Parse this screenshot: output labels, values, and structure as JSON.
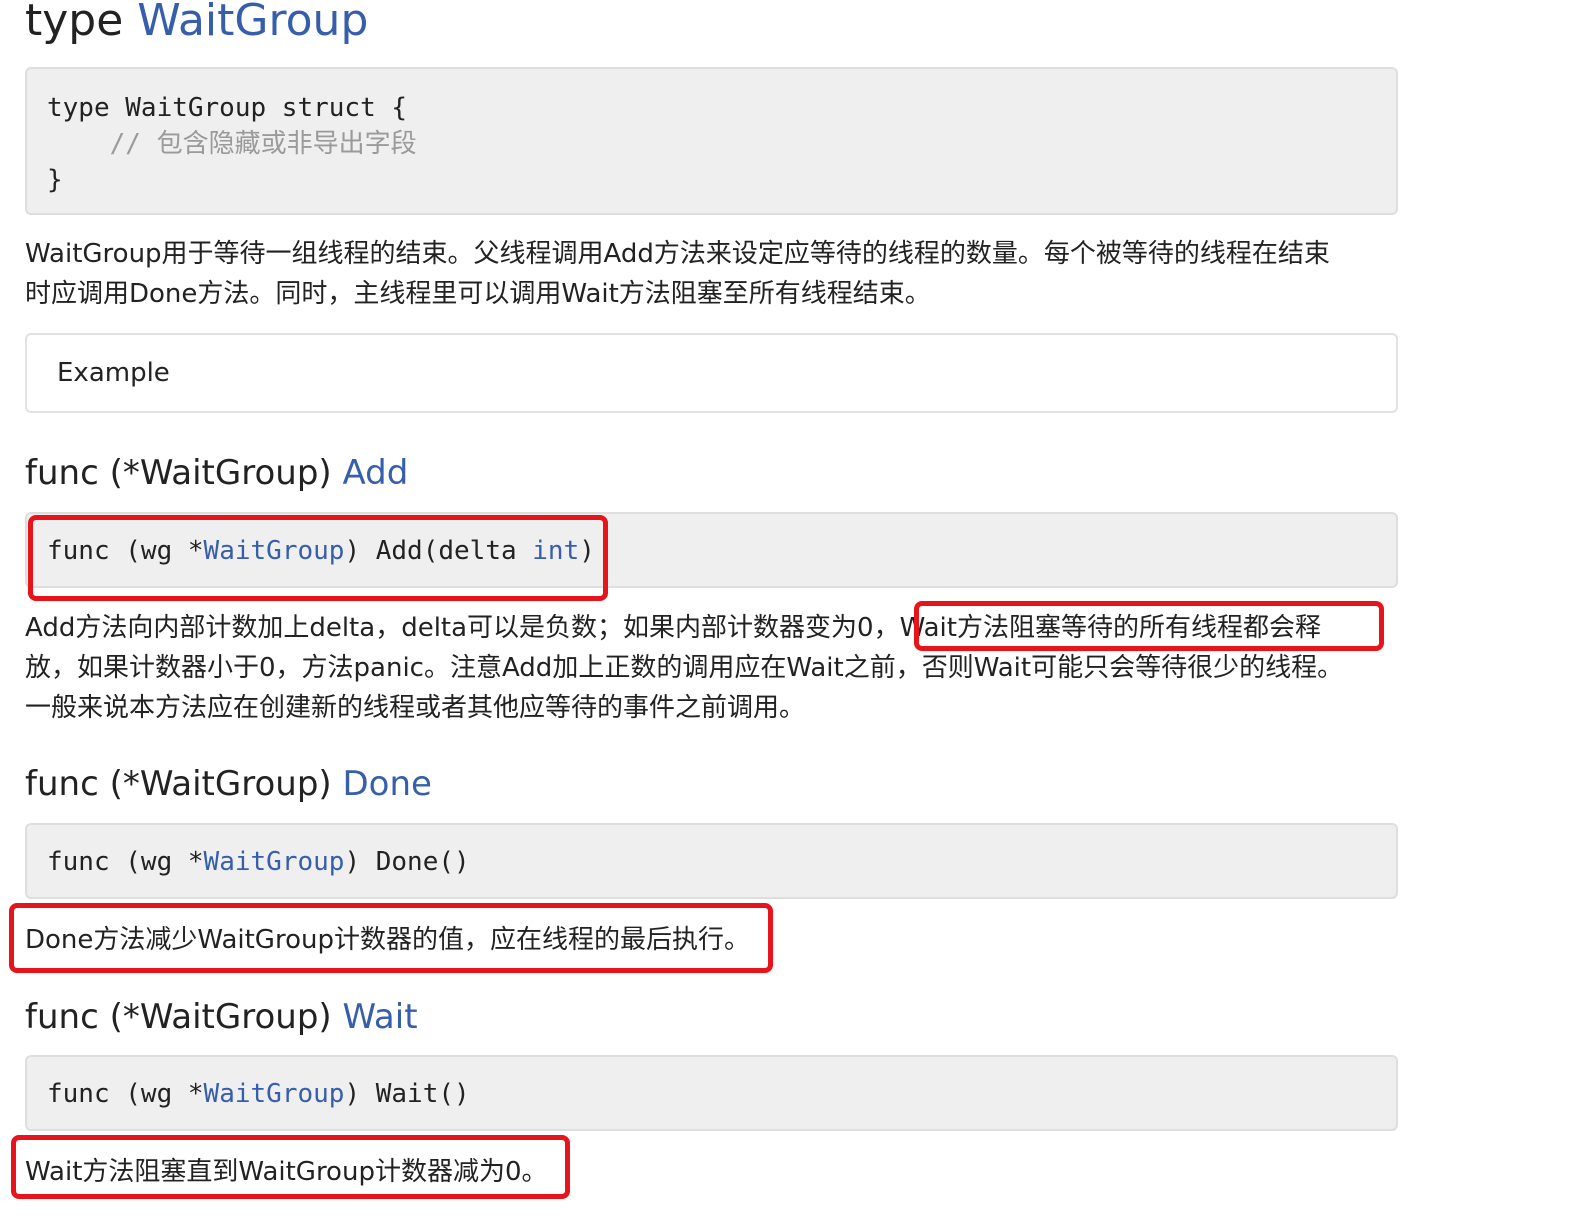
{
  "type_heading": {
    "prefix": "type ",
    "name": "WaitGroup"
  },
  "type_code": {
    "line1": "type WaitGroup struct {",
    "line2": "    // 包含隐藏或非导出字段",
    "line3": "}"
  },
  "type_desc": {
    "line1": "WaitGroup用于等待一组线程的结束。父线程调用Add方法来设定应等待的线程的数量。每个被等待的线程在结束",
    "line2": "时应调用Done方法。同时，主线程里可以调用Wait方法阻塞至所有线程结束。"
  },
  "example": {
    "label": "Example"
  },
  "add": {
    "heading_prefix": "func (*WaitGroup) ",
    "heading_name": "Add",
    "sig_pre": "func (wg *",
    "sig_type": "WaitGroup",
    "sig_mid": ") Add(delta ",
    "sig_int": "int",
    "sig_post": ")",
    "desc_line1": "Add方法向内部计数加上delta，delta可以是负数；如果内部计数器变为0，Wait方法阻塞等待的所有线程都会释",
    "desc_line2": "放，如果计数器小于0，方法panic。注意Add加上正数的调用应在Wait之前，否则Wait可能只会等待很少的线程。",
    "desc_line3": "一般来说本方法应在创建新的线程或者其他应等待的事件之前调用。"
  },
  "done": {
    "heading_prefix": "func (*WaitGroup) ",
    "heading_name": "Done",
    "sig_pre": "func (wg *",
    "sig_type": "WaitGroup",
    "sig_post": ") Done()",
    "desc": "Done方法减少WaitGroup计数器的值，应在线程的最后执行。"
  },
  "wait": {
    "heading_prefix": "func (*WaitGroup) ",
    "heading_name": "Wait",
    "sig_pre": "func (wg *",
    "sig_type": "WaitGroup",
    "sig_post": ") Wait()",
    "desc": "Wait方法阻塞直到WaitGroup计数器减为0。"
  },
  "colors": {
    "link": "#375eab",
    "highlight": "#e8141b",
    "code_bg": "#efefef"
  }
}
